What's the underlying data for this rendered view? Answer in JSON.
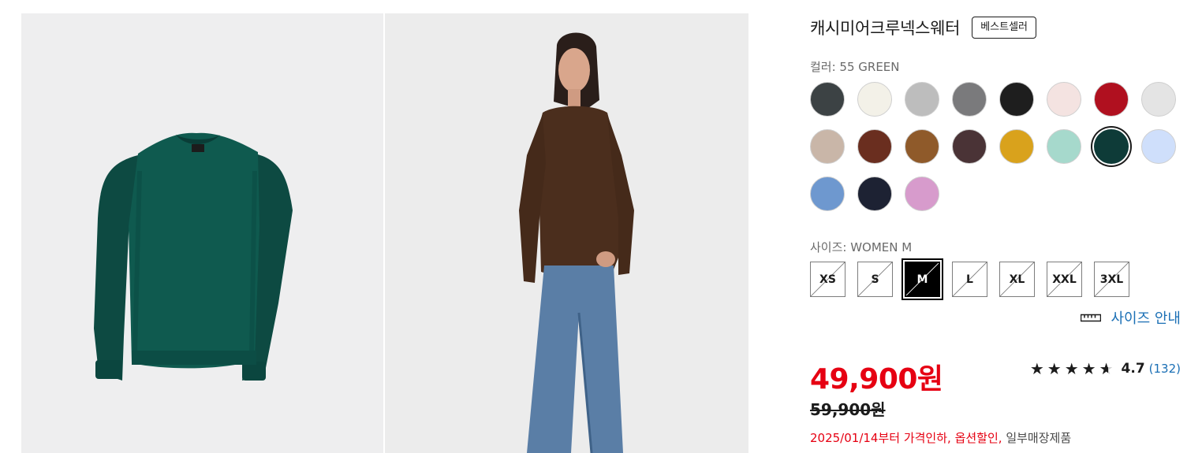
{
  "product": {
    "title": "캐시미어크루넥스웨터",
    "badge": "베스트셀러"
  },
  "color": {
    "label": "컬러: 55 GREEN",
    "swatches": [
      {
        "name": "charcoal",
        "color": "#3c4244"
      },
      {
        "name": "off-white",
        "color": "#f3f1e8"
      },
      {
        "name": "light-gray",
        "color": "#bdbdbd"
      },
      {
        "name": "gray",
        "color": "#7a7a7c"
      },
      {
        "name": "black",
        "color": "#1e1e1e"
      },
      {
        "name": "pale-pink",
        "color": "#f4e3e1"
      },
      {
        "name": "red",
        "color": "#b0101f"
      },
      {
        "name": "white-gray",
        "color": "#e4e4e4"
      },
      {
        "name": "beige",
        "color": "#c9b6a8"
      },
      {
        "name": "brown",
        "color": "#6a2e1f"
      },
      {
        "name": "camel",
        "color": "#8f5a2a"
      },
      {
        "name": "dark-brown",
        "color": "#4a3336"
      },
      {
        "name": "mustard",
        "color": "#d9a21c"
      },
      {
        "name": "mint",
        "color": "#a6d9cc"
      },
      {
        "name": "green",
        "color": "#0e3b38",
        "selected": true
      },
      {
        "name": "light-blue",
        "color": "#cfdffb"
      },
      {
        "name": "blue",
        "color": "#6e98cf"
      },
      {
        "name": "navy",
        "color": "#1d2233"
      },
      {
        "name": "lilac",
        "color": "#d79bcc"
      }
    ]
  },
  "size": {
    "label": "사이즈: WOMEN M",
    "options": [
      {
        "label": "XS"
      },
      {
        "label": "S"
      },
      {
        "label": "M",
        "selected": true
      },
      {
        "label": "L"
      },
      {
        "label": "XL"
      },
      {
        "label": "XXL"
      },
      {
        "label": "3XL"
      }
    ],
    "guide_label": "사이즈 안내",
    "guide_icon": "ruler-icon"
  },
  "pricing": {
    "price": "49,900원",
    "original_price": "59,900원",
    "notice_date": "2025/01/14부터 가격인하,",
    "notice_option": "옵션할인,",
    "notice_store": "일부매장제품"
  },
  "rating": {
    "stars": 4.7,
    "value": "4.7",
    "count": "(132)"
  },
  "theme": {
    "price_color": "#e60012",
    "link_color": "#1a6fb5",
    "selected_color": "#000000"
  }
}
